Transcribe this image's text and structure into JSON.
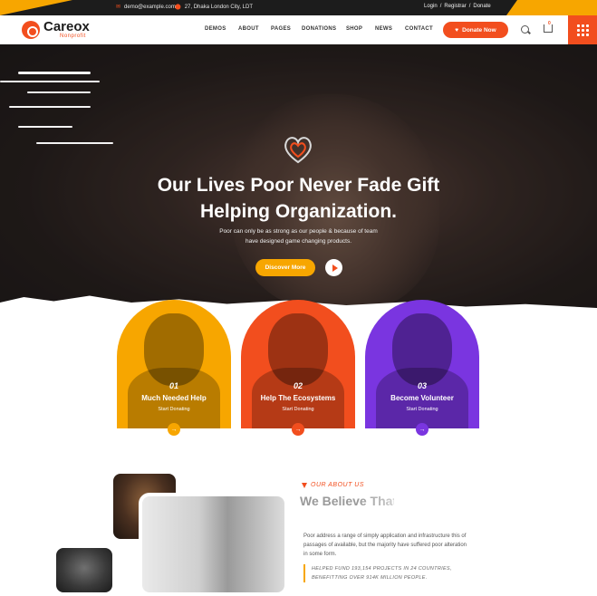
{
  "topbar": {
    "email": "demo@example.com",
    "address": "27, Dhaka London City, LDT",
    "login": "Login",
    "sep1": "/",
    "register": "Registrar",
    "sep2": "/",
    "donate": "Donate"
  },
  "header": {
    "logo_title": "Careox",
    "logo_sub": "Nonprofit",
    "nav": [
      "DEMOS",
      "ABOUT",
      "PAGES",
      "DONATIONS",
      "SHOP",
      "NEWS",
      "CONTACT"
    ],
    "donate_label": "Donate Now",
    "cart_count": "0"
  },
  "hero": {
    "title_line1": "Our Lives Poor Never Fade Gift",
    "title_line2": "Helping Organization.",
    "subtitle_line1": "Poor can only be as strong as our people & because of team",
    "subtitle_line2": "have designed game changing products.",
    "cta_label": "Discover More",
    "slide_active": 3,
    "slide_total": 3
  },
  "cards": [
    {
      "num": "01",
      "title": "Much Needed Help",
      "sub": "Start Donating",
      "color": "#f7a600"
    },
    {
      "num": "02",
      "title": "Help The Ecosystems",
      "sub": "Start Donating",
      "color": "#f24e1e"
    },
    {
      "num": "03",
      "title": "Become Volunteer",
      "sub": "Start Donating",
      "color": "#7a35e0"
    }
  ],
  "about": {
    "tag": "OUR ABOUT US",
    "title": "We Believe That",
    "text": "Poor address a range of simply application and infrastructure this of passages of available, but the majority have suffered poor alteration in some form.",
    "quote": "HELPED FUND 193,154 PROJECTS IN 24 COUNTRIES, BENEFITTING OVER 914K MILLION PEOPLE."
  },
  "colors": {
    "accent": "#f24e1e",
    "secondary": "#f7a600",
    "purple": "#7a35e0",
    "dark": "#1c1c1c"
  }
}
